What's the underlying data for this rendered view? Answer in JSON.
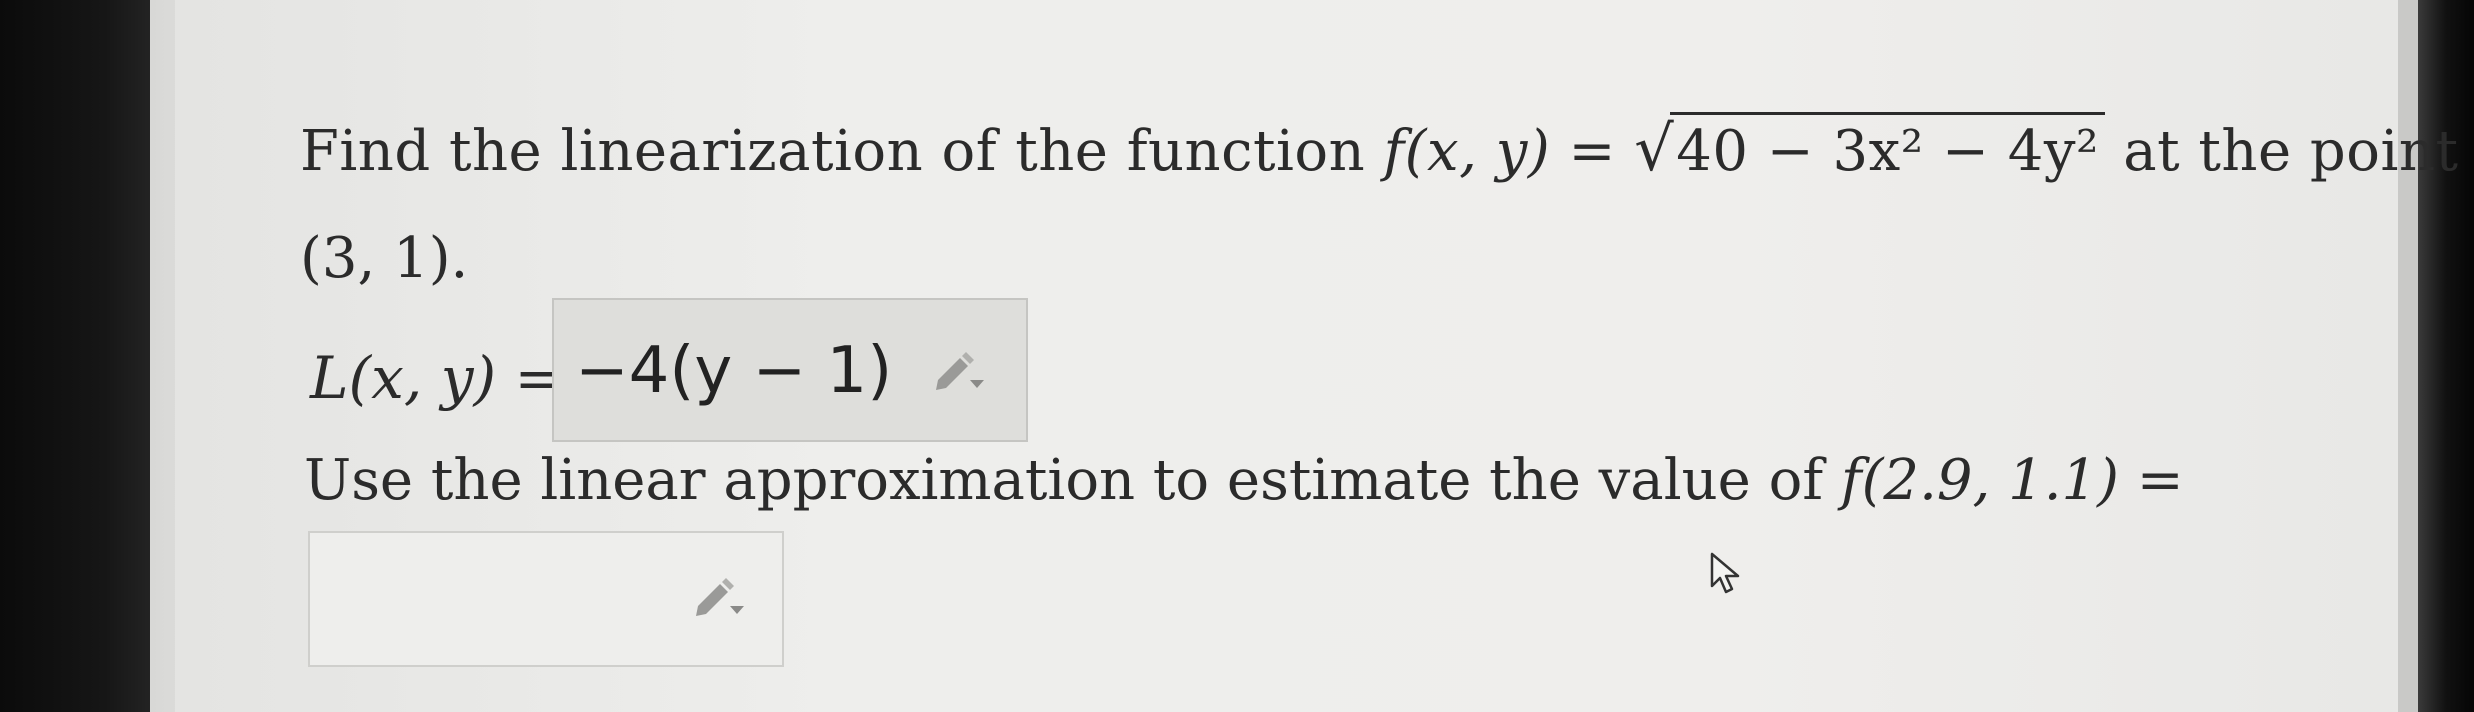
{
  "question": {
    "part1_prefix": "Find the linearization of the function ",
    "function_lhs": "f(x, y) = ",
    "radicand": "40 − 3x² − 4y²",
    "part1_suffix": " at the point",
    "point": "(3, 1).",
    "linearization_label": "L(x, y) =",
    "linearization_answer": "−4(y − 1)",
    "part2_text": "Use the linear approximation to estimate the value of ",
    "part2_expr": "f(2.9, 1.1) ="
  },
  "approximation_answer": "",
  "icons": {
    "answer_editor": "pencil-dropdown-icon",
    "empty_editor": "pencil-dropdown-icon",
    "cursor": "mouse-pointer-icon"
  }
}
